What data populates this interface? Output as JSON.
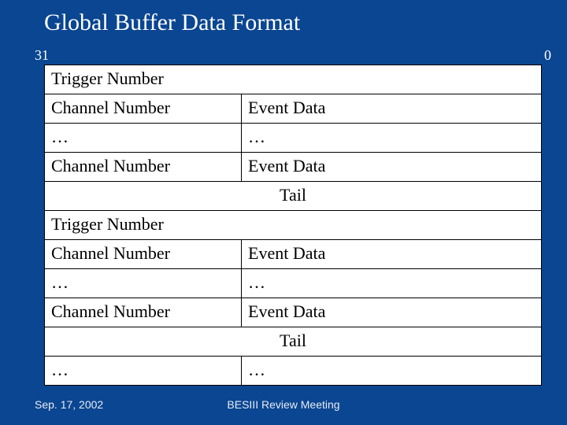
{
  "title": "Global Buffer Data Format",
  "bits": {
    "msb": "31",
    "lsb": "0"
  },
  "rows": [
    {
      "type": "full",
      "text": "Trigger Number"
    },
    {
      "type": "split",
      "left": "Channel Number",
      "right": "Event Data"
    },
    {
      "type": "split",
      "left": "…",
      "right": "…"
    },
    {
      "type": "split",
      "left": "Channel Number",
      "right": "Event Data"
    },
    {
      "type": "center",
      "text": "Tail"
    },
    {
      "type": "full",
      "text": "Trigger Number"
    },
    {
      "type": "split",
      "left": "Channel Number",
      "right": "Event Data"
    },
    {
      "type": "split",
      "left": "…",
      "right": "…"
    },
    {
      "type": "split",
      "left": "Channel Number",
      "right": "Event Data"
    },
    {
      "type": "center",
      "text": "Tail"
    },
    {
      "type": "split",
      "left": "…",
      "right": "…"
    }
  ],
  "footer": {
    "date": "Sep. 17, 2002",
    "center": "BESIII Review Meeting"
  }
}
